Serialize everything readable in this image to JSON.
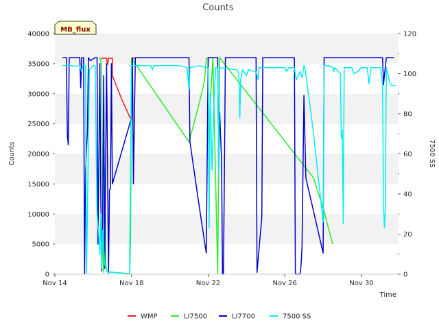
{
  "chart_data": {
    "type": "line",
    "title": "Counts",
    "xlabel": "Time",
    "ylabel": "Counts",
    "y2label": "7500 SS",
    "badge": "MB_flux",
    "x_tick_labels": [
      "Nov 14",
      "Nov 18",
      "Nov 22",
      "Nov 26",
      "Nov 30"
    ],
    "x_tick_days": [
      14,
      18,
      22,
      26,
      30
    ],
    "xlim_days": [
      14,
      31.9
    ],
    "ylim": [
      0,
      40000
    ],
    "y_ticks": [
      0,
      5000,
      10000,
      15000,
      20000,
      25000,
      30000,
      35000,
      40000
    ],
    "y2lim": [
      0,
      120
    ],
    "y2_ticks": [
      0,
      20,
      40,
      60,
      80,
      100,
      120
    ],
    "grid_bands": true,
    "legend_position": "bottom-center",
    "series": [
      {
        "name": "WMP",
        "color": "#e41a1c",
        "axis": "left",
        "points": [
          [
            16.4,
            35900
          ],
          [
            16.7,
            35900
          ],
          [
            16.75,
            34800
          ],
          [
            16.8,
            35900
          ],
          [
            17.0,
            35900
          ],
          [
            17.0,
            33000
          ],
          [
            17.5,
            29000
          ],
          [
            18.0,
            25500
          ],
          [
            18.0,
            35900
          ],
          [
            18.2,
            35900
          ]
        ]
      },
      {
        "name": "LI7500",
        "color": "#22ee22",
        "axis": "left",
        "points": [
          [
            16.3,
            36000
          ],
          [
            16.4,
            35700
          ],
          [
            16.45,
            33000
          ],
          [
            16.5,
            5000
          ],
          [
            16.55,
            300
          ],
          [
            16.6,
            17700
          ],
          [
            16.65,
            2000
          ],
          [
            16.7,
            500
          ],
          [
            16.8,
            400
          ],
          [
            17.0,
            300
          ],
          [
            17.5,
            200
          ],
          [
            17.9,
            100
          ],
          [
            17.95,
            5000
          ],
          [
            18.0,
            35900
          ],
          [
            21.0,
            22000
          ],
          [
            21.5,
            28000
          ],
          [
            21.8,
            32000
          ],
          [
            21.9,
            35800
          ],
          [
            22.0,
            36000
          ],
          [
            22.05,
            11000
          ],
          [
            22.1,
            28000
          ],
          [
            22.2,
            33500
          ],
          [
            22.25,
            36000
          ],
          [
            22.5,
            0
          ],
          [
            22.6,
            36000
          ],
          [
            27.5,
            16000
          ],
          [
            28.0,
            11000
          ],
          [
            28.5,
            5000
          ]
        ]
      },
      {
        "name": "LI7700",
        "color": "#0000cc",
        "axis": "left",
        "points": [
          [
            14.4,
            36000
          ],
          [
            14.6,
            36000
          ],
          [
            14.65,
            23000
          ],
          [
            14.7,
            21500
          ],
          [
            14.75,
            36000
          ],
          [
            15.3,
            36000
          ],
          [
            15.35,
            31000
          ],
          [
            15.4,
            36000
          ],
          [
            15.5,
            36000
          ],
          [
            15.55,
            0
          ],
          [
            15.6,
            17000
          ],
          [
            15.7,
            24000
          ],
          [
            15.75,
            36000
          ],
          [
            15.85,
            35500
          ],
          [
            16.1,
            36000
          ],
          [
            16.2,
            36000
          ],
          [
            16.25,
            5000
          ],
          [
            16.3,
            20000
          ],
          [
            16.35,
            35000
          ],
          [
            16.4,
            12000
          ],
          [
            16.45,
            500
          ],
          [
            16.5,
            10000
          ],
          [
            16.55,
            33000
          ],
          [
            16.6,
            1000
          ],
          [
            16.7,
            35000
          ],
          [
            16.8,
            200
          ],
          [
            16.85,
            14000
          ],
          [
            16.9,
            14200
          ],
          [
            16.95,
            35000
          ],
          [
            17.0,
            15000
          ],
          [
            18.0,
            26000
          ],
          [
            18.05,
            36000
          ],
          [
            18.1,
            15000
          ],
          [
            18.2,
            36000
          ],
          [
            21.0,
            36000
          ],
          [
            21.05,
            22000
          ],
          [
            21.5,
            12000
          ],
          [
            21.9,
            3500
          ],
          [
            22.0,
            36000
          ],
          [
            22.5,
            36000
          ],
          [
            22.55,
            17000
          ],
          [
            22.6,
            27000
          ],
          [
            22.7,
            19000
          ],
          [
            22.75,
            0
          ],
          [
            22.8,
            0
          ],
          [
            22.9,
            36000
          ],
          [
            24.5,
            36000
          ],
          [
            24.55,
            300
          ],
          [
            24.8,
            9500
          ],
          [
            24.85,
            36000
          ],
          [
            26.5,
            36000
          ],
          [
            26.55,
            0
          ],
          [
            26.8,
            0
          ],
          [
            26.85,
            1500
          ],
          [
            26.9,
            4500
          ],
          [
            27.0,
            29700
          ],
          [
            27.1,
            16000
          ],
          [
            28.0,
            3500
          ],
          [
            28.05,
            36000
          ],
          [
            31.1,
            36000
          ],
          [
            31.15,
            31500
          ],
          [
            31.2,
            33000
          ],
          [
            31.3,
            36000
          ],
          [
            31.7,
            36000
          ]
        ]
      },
      {
        "name": "7500 SS",
        "color": "#00eeee",
        "axis": "right",
        "points": [
          [
            14.4,
            104
          ],
          [
            14.9,
            104
          ],
          [
            15.0,
            103.6
          ],
          [
            15.3,
            104
          ],
          [
            15.4,
            101
          ],
          [
            15.45,
            104
          ],
          [
            15.6,
            104
          ],
          [
            15.65,
            0
          ],
          [
            15.7,
            30
          ],
          [
            15.8,
            102
          ],
          [
            15.9,
            103
          ],
          [
            16.0,
            104
          ],
          [
            16.1,
            104
          ],
          [
            16.2,
            30
          ],
          [
            16.3,
            18
          ],
          [
            16.35,
            10
          ],
          [
            16.4,
            30
          ],
          [
            16.45,
            3
          ],
          [
            16.5,
            22
          ],
          [
            16.6,
            5
          ],
          [
            16.7,
            1.5
          ],
          [
            16.8,
            1
          ],
          [
            17.0,
            1
          ],
          [
            17.5,
            0.5
          ],
          [
            17.9,
            0
          ],
          [
            18.0,
            104
          ],
          [
            19.0,
            104
          ],
          [
            19.1,
            102
          ],
          [
            19.15,
            104
          ],
          [
            20.5,
            104
          ],
          [
            20.9,
            103
          ],
          [
            21.0,
            92
          ],
          [
            21.05,
            103
          ],
          [
            21.5,
            104
          ],
          [
            21.9,
            103
          ],
          [
            22.0,
            103
          ],
          [
            22.05,
            23
          ],
          [
            22.1,
            90
          ],
          [
            22.2,
            52
          ],
          [
            22.3,
            85
          ],
          [
            22.4,
            103
          ],
          [
            22.5,
            103
          ],
          [
            22.55,
            50
          ],
          [
            22.6,
            103
          ],
          [
            23.5,
            102
          ],
          [
            23.6,
            100
          ],
          [
            23.65,
            78
          ],
          [
            23.7,
            97
          ],
          [
            23.8,
            102
          ],
          [
            24.0,
            99
          ],
          [
            24.1,
            102
          ],
          [
            24.5,
            101
          ],
          [
            24.6,
            97
          ],
          [
            24.65,
            103
          ],
          [
            26.0,
            103
          ],
          [
            26.1,
            101
          ],
          [
            26.2,
            103
          ],
          [
            26.5,
            103
          ],
          [
            26.6,
            97
          ],
          [
            26.8,
            101
          ],
          [
            26.9,
            98
          ],
          [
            27.0,
            104
          ],
          [
            27.05,
            103
          ],
          [
            27.1,
            100
          ],
          [
            27.5,
            70
          ],
          [
            28.0,
            26
          ],
          [
            28.05,
            104
          ],
          [
            28.3,
            104
          ],
          [
            28.5,
            103
          ],
          [
            28.55,
            101
          ],
          [
            28.6,
            103
          ],
          [
            28.9,
            100
          ],
          [
            28.95,
            68
          ],
          [
            29.0,
            72
          ],
          [
            29.05,
            25
          ],
          [
            29.1,
            103
          ],
          [
            29.5,
            103
          ],
          [
            29.6,
            100
          ],
          [
            29.8,
            101
          ],
          [
            30.0,
            103
          ],
          [
            30.3,
            103
          ],
          [
            30.4,
            95
          ],
          [
            30.5,
            103
          ],
          [
            31.0,
            103
          ],
          [
            31.1,
            95
          ],
          [
            31.15,
            35
          ],
          [
            31.2,
            23
          ],
          [
            31.25,
            32
          ],
          [
            31.3,
            103
          ],
          [
            31.5,
            95
          ],
          [
            31.6,
            94
          ],
          [
            31.8,
            94
          ]
        ]
      }
    ]
  }
}
